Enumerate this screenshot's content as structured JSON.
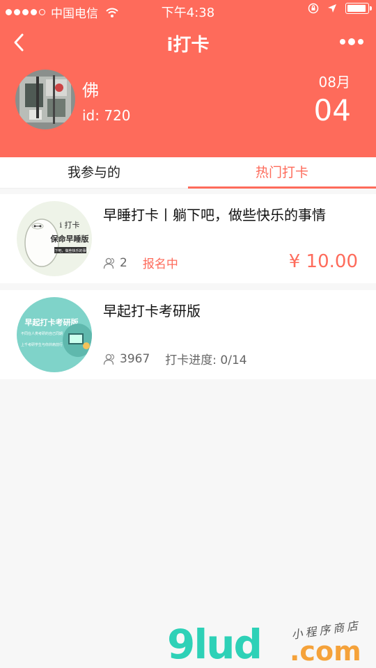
{
  "status_bar": {
    "carrier": "中国电信",
    "time": "下午4:38",
    "signal_icon": "signal-dots-icon",
    "wifi_icon": "wifi-icon",
    "battery_icon": "battery-icon"
  },
  "nav": {
    "title": "i打卡",
    "back_icon": "chevron-left-icon",
    "more_icon": "more-dots-icon"
  },
  "profile": {
    "name": "佛",
    "id_text": "id: 720",
    "month": "08月",
    "day": "04"
  },
  "tabs": [
    {
      "label": "我参与的",
      "active": false
    },
    {
      "label": "热门打卡",
      "active": true
    }
  ],
  "cards": [
    {
      "title": "早睡打卡丨躺下吧，做些快乐的事情",
      "count": "2",
      "status": "报名中",
      "price": "¥ 10.00",
      "thumb_text": [
        "i 打卡",
        "保命早睡版",
        "躺下吧，做些快乐的事情"
      ]
    },
    {
      "title": "早起打卡考研版",
      "count": "3967",
      "progress": "打卡进度: 0/14",
      "thumb_text": [
        "早起打卡考研版",
        "不同在人类考研的自己同期",
        "上千考研学生与你并肩前行"
      ]
    }
  ],
  "watermark": {
    "logo": "9lud",
    "domain": ".com",
    "tagline": "小程序商店"
  },
  "colors": {
    "accent": "#fe6b5b",
    "background": "#f7f7f7",
    "teal": "#2ed1b7",
    "orange": "#f5a23a"
  }
}
